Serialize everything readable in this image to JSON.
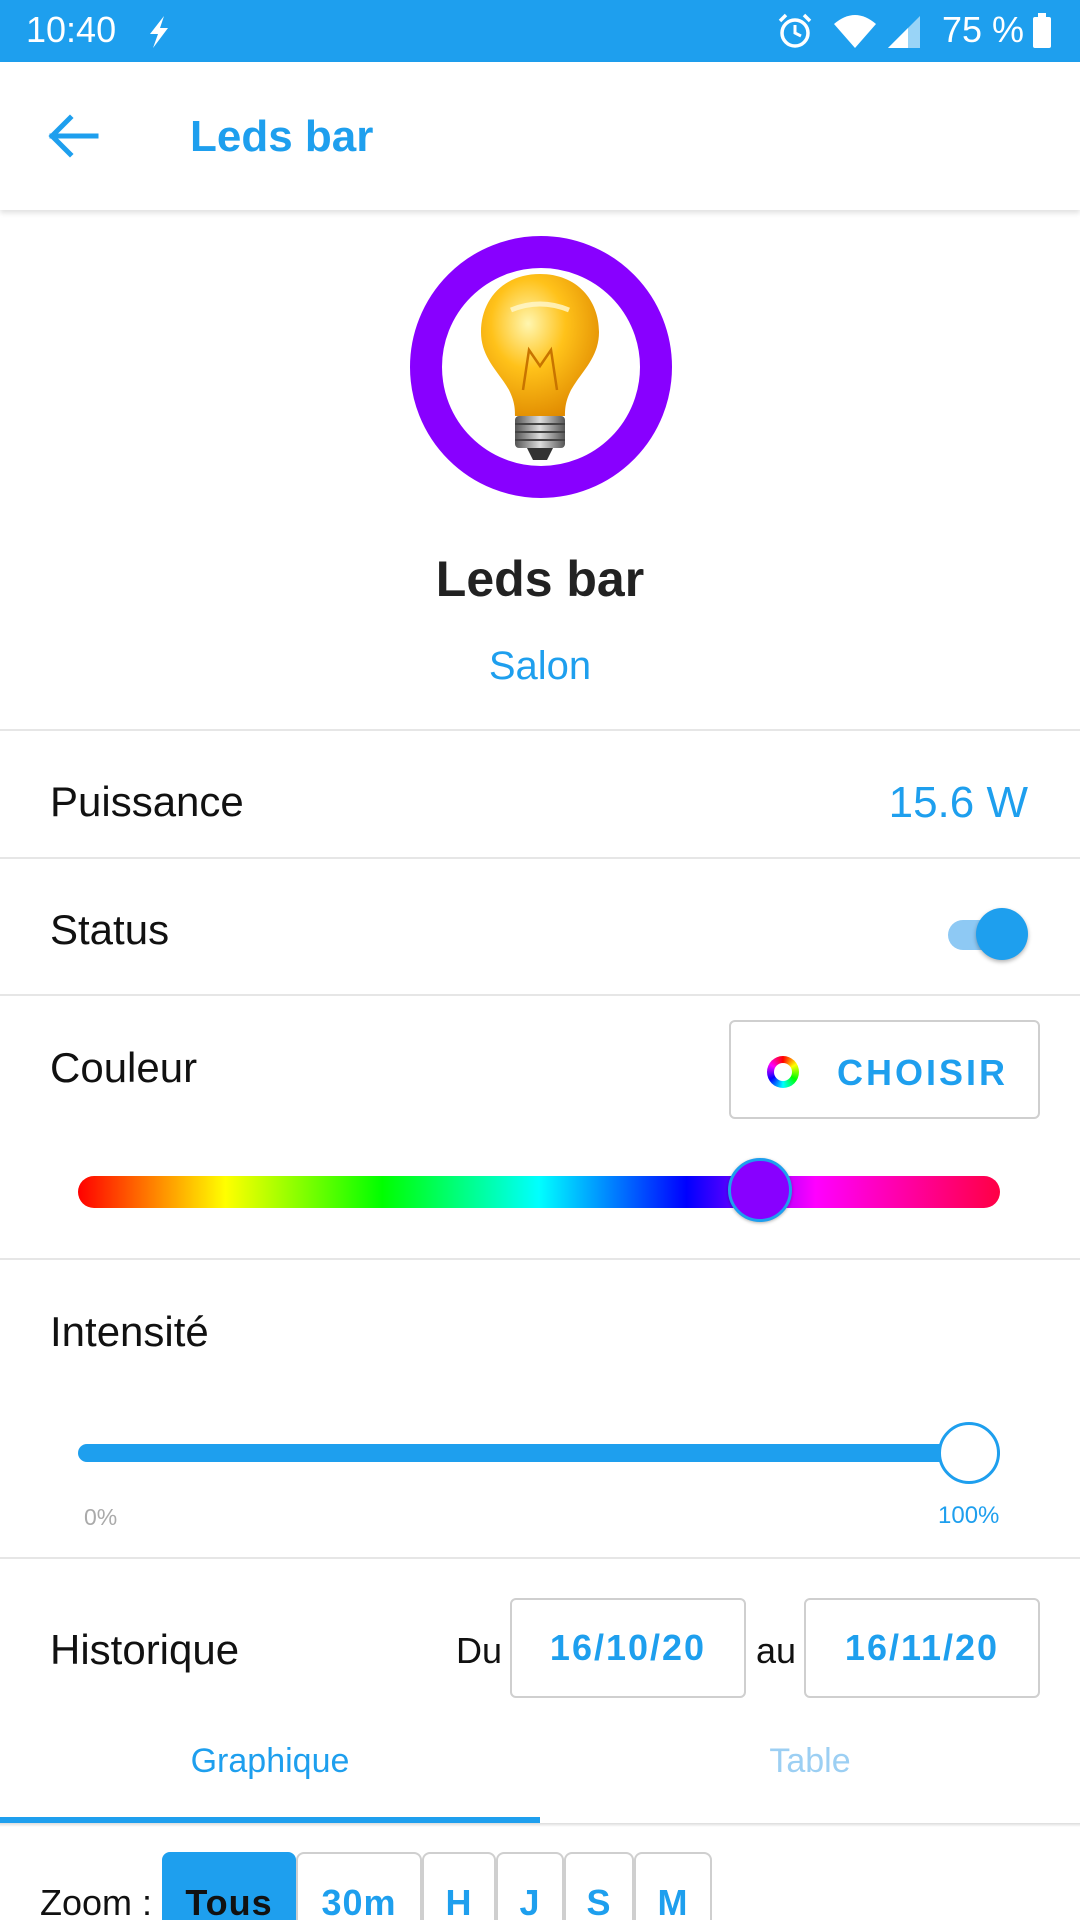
{
  "status_bar": {
    "time": "10:40",
    "battery_text": "75 %",
    "icons": [
      "charging-bolt-icon",
      "alarm-icon",
      "wifi-icon",
      "signal-icon",
      "battery-icon"
    ],
    "color": "#1e9fee"
  },
  "app_bar": {
    "title": "Leds bar",
    "back_icon": "arrow-left-icon"
  },
  "device": {
    "name": "Leds bar",
    "room": "Salon",
    "icon": "light-bulb-icon",
    "ring_color": "#8800ff"
  },
  "power": {
    "label": "Puissance",
    "value": "15.6 W"
  },
  "status": {
    "label": "Status",
    "on": true
  },
  "color": {
    "label": "Couleur",
    "choose_label": "CHOISIR",
    "selected_color": "#8800ff",
    "hue_position": 0.74
  },
  "intensity": {
    "label": "Intensité",
    "min_label": "0%",
    "max_label": "100%",
    "value": 1.0
  },
  "history": {
    "label": "Historique",
    "from_label": "Du",
    "from_date": "16/10/20",
    "to_label": "au",
    "to_date": "16/11/20",
    "tabs": [
      {
        "label": "Graphique",
        "active": true
      },
      {
        "label": "Table",
        "active": false
      }
    ],
    "zoom_label": "Zoom :",
    "zoom_options": [
      "Tous",
      "30m",
      "H",
      "J",
      "S",
      "M"
    ],
    "zoom_selected": "Tous"
  },
  "accent_color": "#1e9fee"
}
